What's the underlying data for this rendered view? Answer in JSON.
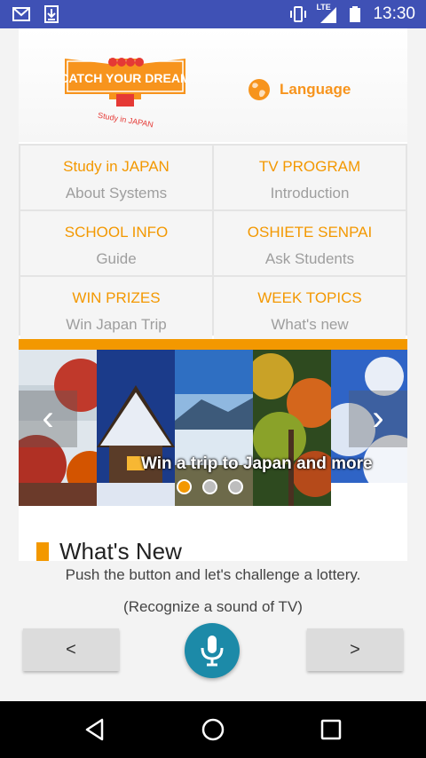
{
  "status_bar": {
    "time": "13:30",
    "network": "LTE",
    "icons": [
      "gmail-icon",
      "download-icon",
      "vibrate-icon",
      "signal-icon",
      "battery-icon"
    ]
  },
  "header": {
    "logo_text": "CATCH YOUR DREAM",
    "logo_subtext": "Study in JAPAN",
    "language_label": "Language"
  },
  "menu": [
    {
      "title": "Study in JAPAN",
      "subtitle": "About Systems"
    },
    {
      "title": "TV PROGRAM",
      "subtitle": "Introduction"
    },
    {
      "title": "SCHOOL INFO",
      "subtitle": "Guide"
    },
    {
      "title": "OSHIETE SENPAI",
      "subtitle": "Ask Students"
    },
    {
      "title": "WIN PRIZES",
      "subtitle": "Win Japan Trip"
    },
    {
      "title": "WEEK TOPICS",
      "subtitle": "What's new"
    }
  ],
  "carousel": {
    "caption": "Win a trip to Japan and more",
    "prev_symbol": "‹",
    "next_symbol": "›",
    "slide_count": 3,
    "active_index": 0
  },
  "whats_new": {
    "title": "What's New"
  },
  "bottom": {
    "hint_line1": "Push the button and let's challenge a lottery.",
    "hint_line2": "(Recognize a sound of TV)",
    "prev_label": "<",
    "next_label": ">"
  },
  "colors": {
    "accent": "#f39800",
    "status_bar": "#3f51b5",
    "mic_button": "#1c8aa8"
  }
}
